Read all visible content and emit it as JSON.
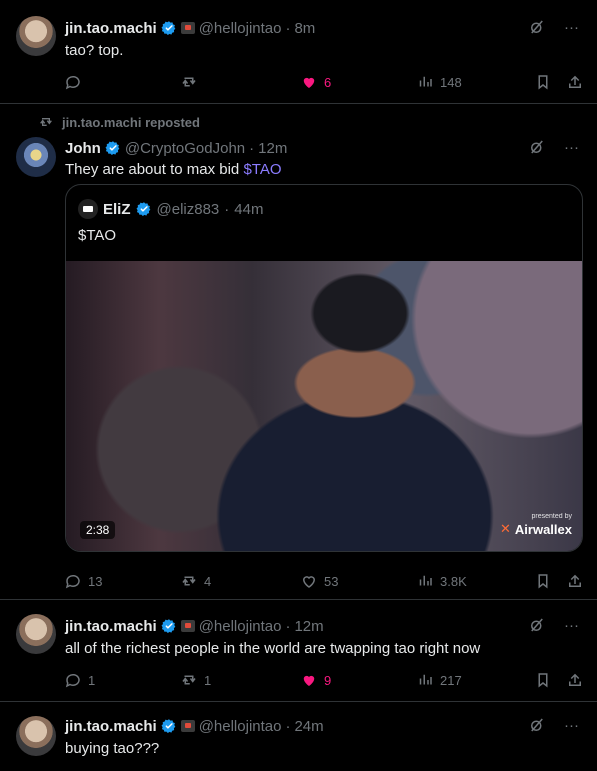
{
  "tweets": [
    {
      "name": "jin.tao.machi",
      "handle": "@hellojintao",
      "time": "8m",
      "text": "tao? top.",
      "replies": "",
      "retweets": "",
      "likes": "6",
      "views": "148"
    },
    {
      "repost_label": "jin.tao.machi reposted",
      "name": "John",
      "handle": "@CryptoGodJohn",
      "time": "12m",
      "text": "They are about to max bid",
      "cashtag": "$TAO",
      "quote": {
        "name": "EliZ",
        "handle": "@eliz883",
        "time": "44m",
        "text": "$TAO",
        "video_duration": "2:38",
        "sponsor_small": "presented by",
        "sponsor_name": "Airwallex"
      },
      "replies": "13",
      "retweets": "4",
      "likes": "53",
      "views": "3.8K"
    },
    {
      "name": "jin.tao.machi",
      "handle": "@hellojintao",
      "time": "12m",
      "text": "all of the richest people in the world are twapping tao right now",
      "replies": "1",
      "retweets": "1",
      "likes": "9",
      "views": "217"
    },
    {
      "name": "jin.tao.machi",
      "handle": "@hellojintao",
      "time": "24m",
      "text": "buying tao???"
    }
  ],
  "ui": {
    "dot": "·",
    "more": "···"
  },
  "colors": {
    "background": "#000000",
    "divider": "#2f3336",
    "muted": "#71767b",
    "like_active": "#f91880",
    "verified": "#1d9bf0",
    "cashtag": "#8b7cff"
  }
}
